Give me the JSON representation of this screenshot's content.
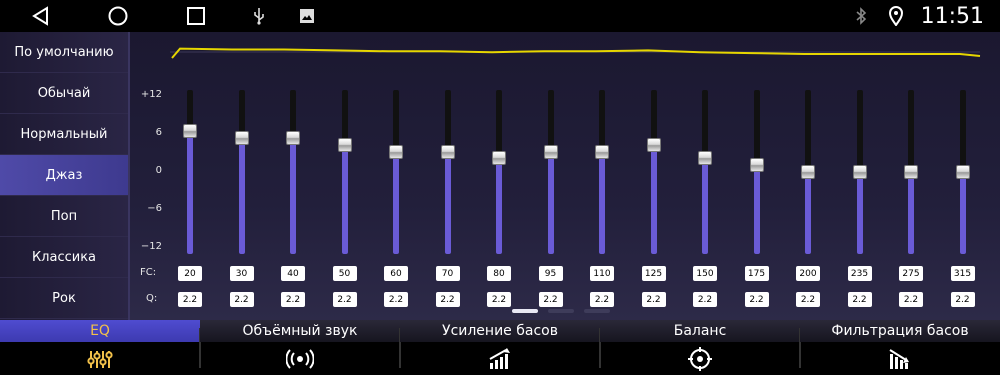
{
  "status_bar": {
    "time": "11:51",
    "icons": [
      "back-icon",
      "home-icon",
      "recents-icon",
      "usb-icon",
      "image-icon",
      "bluetooth-icon",
      "location-icon"
    ]
  },
  "presets": {
    "active": "Джаз",
    "items": [
      "По умолчанию",
      "Обычай",
      "Нормальный",
      "Джаз",
      "Поп",
      "Классика",
      "Рок"
    ]
  },
  "equalizer": {
    "db_scale": [
      "+12",
      "6",
      "0",
      "−6",
      "−12"
    ],
    "fc_label": "FC:",
    "q_label": "Q:",
    "bands": [
      {
        "fc": "20",
        "q": "2.2",
        "gain": 6
      },
      {
        "fc": "30",
        "q": "2.2",
        "gain": 5
      },
      {
        "fc": "40",
        "q": "2.2",
        "gain": 5
      },
      {
        "fc": "50",
        "q": "2.2",
        "gain": 4
      },
      {
        "fc": "60",
        "q": "2.2",
        "gain": 3
      },
      {
        "fc": "70",
        "q": "2.2",
        "gain": 3
      },
      {
        "fc": "80",
        "q": "2.2",
        "gain": 2
      },
      {
        "fc": "95",
        "q": "2.2",
        "gain": 3
      },
      {
        "fc": "110",
        "q": "2.2",
        "gain": 3
      },
      {
        "fc": "125",
        "q": "2.2",
        "gain": 4
      },
      {
        "fc": "150",
        "q": "2.2",
        "gain": 2
      },
      {
        "fc": "175",
        "q": "2.2",
        "gain": 1
      },
      {
        "fc": "200",
        "q": "2.2",
        "gain": 0
      },
      {
        "fc": "235",
        "q": "2.2",
        "gain": 0
      },
      {
        "fc": "275",
        "q": "2.2",
        "gain": 0
      },
      {
        "fc": "315",
        "q": "2.2",
        "gain": 0
      }
    ],
    "curve_color": "#e6d600",
    "slider_color": "#6a5bd6",
    "page_count": 3,
    "active_page": 1
  },
  "tabs": [
    {
      "label": "EQ",
      "icon": "equalizer-icon",
      "active": true
    },
    {
      "label": "Объёмный звук",
      "icon": "surround-sound-icon",
      "active": false
    },
    {
      "label": "Усиление басов",
      "icon": "bass-boost-icon",
      "active": false
    },
    {
      "label": "Баланс",
      "icon": "balance-icon",
      "active": false
    },
    {
      "label": "Фильтрация басов",
      "icon": "bass-filter-icon",
      "active": false
    }
  ],
  "colors": {
    "active_tab_text": "#f2c14a",
    "active_tab_bg": "#4f4cd0",
    "active_preset_bg": "#4f4aa8"
  }
}
